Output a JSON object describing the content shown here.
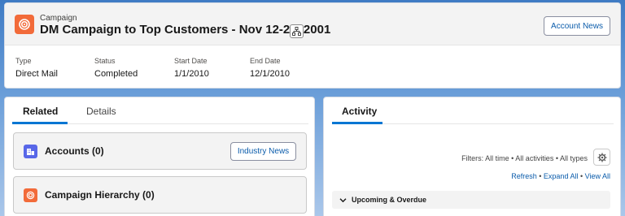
{
  "header": {
    "object_label": "Campaign",
    "record_title": "DM Campaign to Top Customers - Nov 12-23, 2001",
    "account_news_label": "Account News",
    "icons": {
      "object": "campaign-icon",
      "hierarchy": "hierarchy-icon"
    },
    "fields": [
      {
        "label": "Type",
        "value": "Direct Mail"
      },
      {
        "label": "Status",
        "value": "Completed"
      },
      {
        "label": "Start Date",
        "value": "1/1/2010"
      },
      {
        "label": "End Date",
        "value": "12/1/2010"
      }
    ]
  },
  "related": {
    "tabs": [
      {
        "label": "Related",
        "active": true
      },
      {
        "label": "Details",
        "active": false
      }
    ],
    "lists": [
      {
        "title": "Accounts (0)",
        "icon": "account-icon",
        "icon_color": "#5867e8",
        "button_label": "Industry News"
      },
      {
        "title": "Campaign Hierarchy (0)",
        "icon": "campaign-icon",
        "icon_color": "#f26b3a"
      }
    ]
  },
  "activity": {
    "tab_label": "Activity",
    "filters_text": "Filters: All time • All activities • All types",
    "links": {
      "refresh": "Refresh",
      "expand_all": "Expand All",
      "view_all": "View All",
      "separator": "•"
    },
    "section_label": "Upcoming & Overdue",
    "icons": {
      "settings": "gear-icon",
      "section": "chevron-down-icon"
    }
  },
  "colors": {
    "accent": "#0176d3",
    "link": "#0b5cab",
    "campaign": "#f26b3a",
    "account": "#5867e8"
  }
}
